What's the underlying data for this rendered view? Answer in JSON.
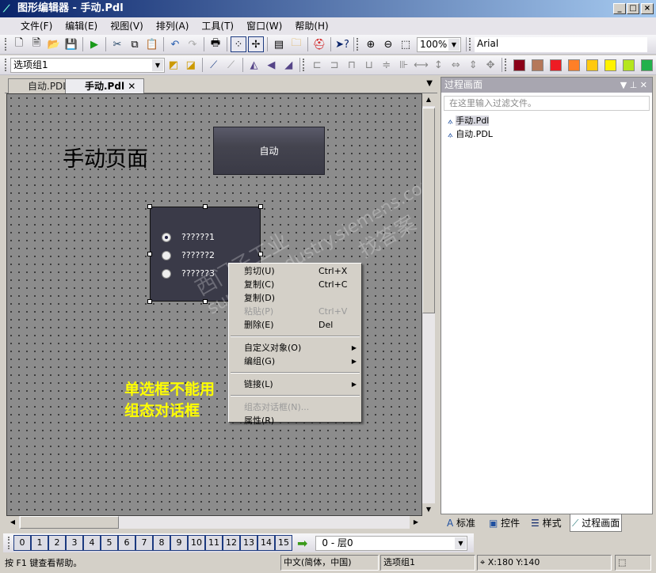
{
  "window": {
    "title": "图形编辑器 - 手动.Pdl",
    "min": "_",
    "max": "□",
    "close": "×"
  },
  "menu": [
    "文件(F)",
    "编辑(E)",
    "视图(V)",
    "排列(A)",
    "工具(T)",
    "窗口(W)",
    "帮助(H)"
  ],
  "toolbar": {
    "zoom": "100%",
    "font": "Arial",
    "object_select": "选项组1"
  },
  "palette": [
    "#8b0018",
    "#b5785a",
    "#ee1c24",
    "#ff7f27",
    "#ffc90e",
    "#fff200",
    "#b5e61d",
    "#22b14c"
  ],
  "doc_tabs": [
    {
      "label": "自动.PDL",
      "active": false
    },
    {
      "label": "手动.Pdl",
      "active": true
    }
  ],
  "canvas": {
    "static_text": "手动页面",
    "button_label": "自动",
    "radio_options": [
      {
        "label": "??????1",
        "checked": true
      },
      {
        "label": "??????2",
        "checked": false
      },
      {
        "label": "??????3",
        "checked": false
      }
    ],
    "annotation": [
      "单选框不能用",
      "组态对话框"
    ],
    "annotation_color": "#ffff00",
    "watermark": [
      "西门子工业",
      "support.industry.siemens.com/cs",
      "找答案"
    ]
  },
  "context_menu": [
    {
      "label": "剪切(U)",
      "shortcut": "Ctrl+X"
    },
    {
      "label": "复制(C)",
      "shortcut": "Ctrl+C"
    },
    {
      "label": "复制(D)"
    },
    {
      "label": "粘贴(P)",
      "shortcut": "Ctrl+V",
      "disabled": true
    },
    {
      "label": "删除(E)",
      "shortcut": "Del"
    },
    {
      "sep": true
    },
    {
      "label": "自定义对象(O)",
      "submenu": true
    },
    {
      "label": "编组(G)",
      "submenu": true
    },
    {
      "sep": true
    },
    {
      "label": "链接(L)",
      "submenu": true
    },
    {
      "sep": true
    },
    {
      "label": "组态对话框(N)...",
      "disabled": true
    },
    {
      "label": "属性(R)"
    }
  ],
  "right_panel": {
    "title": "过程画面",
    "filter_placeholder": "在这里输入过滤文件。",
    "files": [
      "手动.Pdl",
      "自动.PDL"
    ]
  },
  "bottom_tabs": [
    "标准",
    "控件",
    "样式",
    "过程画面"
  ],
  "layers": {
    "buttons": [
      "0",
      "1",
      "2",
      "3",
      "4",
      "5",
      "6",
      "7",
      "8",
      "9",
      "10",
      "11",
      "12",
      "13",
      "14",
      "15"
    ],
    "selected": "0 - 层0"
  },
  "status": {
    "help": "按 F1 键查看帮助。",
    "language": "中文(简体，中国)",
    "object": "选项组1",
    "coords": "X:180 Y:140"
  }
}
